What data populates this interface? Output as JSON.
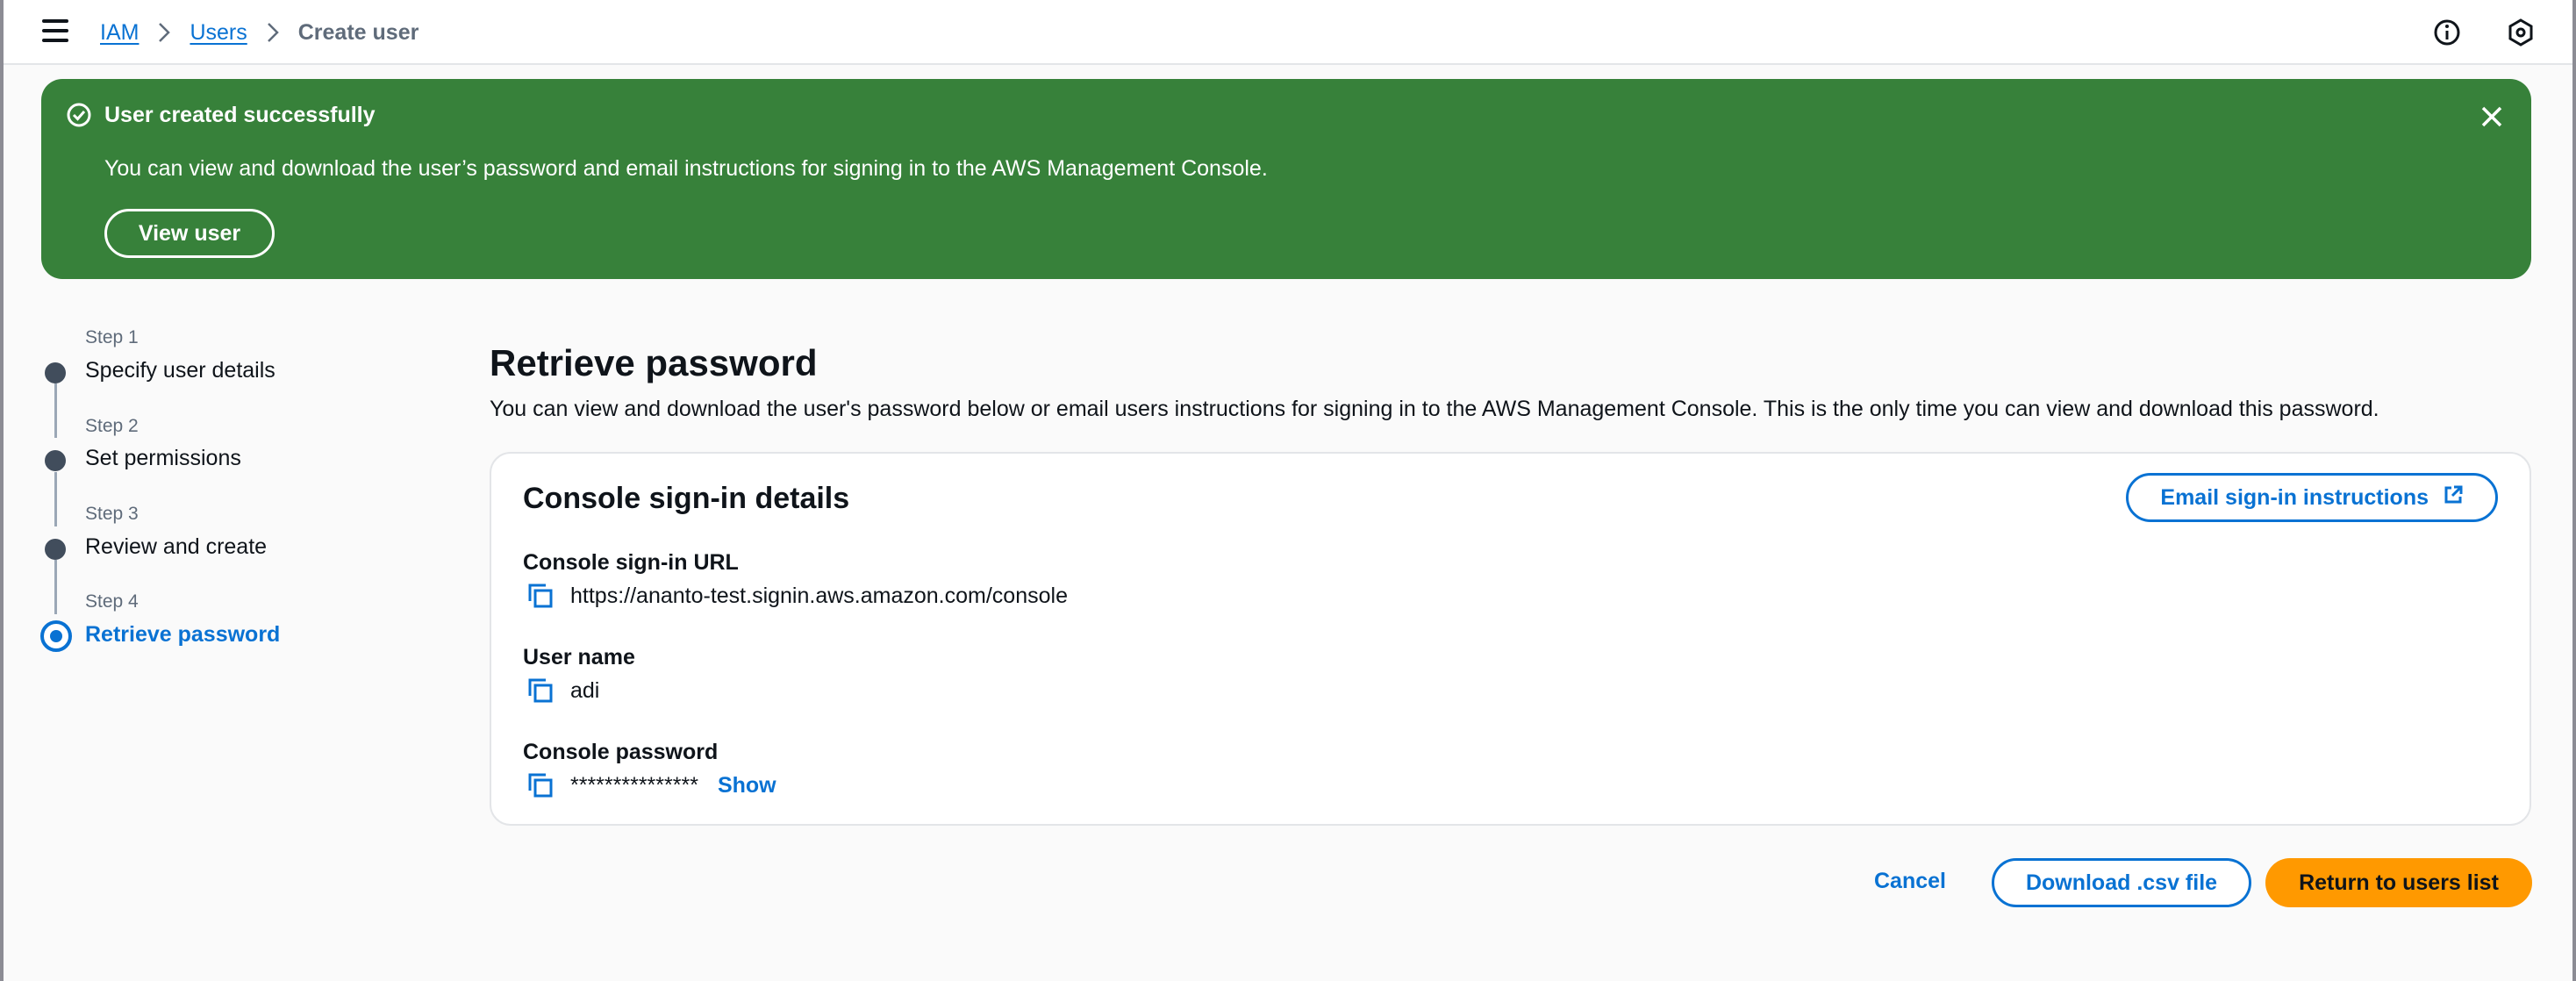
{
  "breadcrumb": {
    "items": [
      "IAM",
      "Users"
    ],
    "current": "Create user"
  },
  "flash": {
    "title": "User created successfully",
    "message": "You can view and download the user’s password and email instructions for signing in to the AWS Management Console.",
    "button": "View user",
    "color": "#37813a"
  },
  "steps": [
    {
      "num": "Step 1",
      "label": "Specify user details"
    },
    {
      "num": "Step 2",
      "label": "Set permissions"
    },
    {
      "num": "Step 3",
      "label": "Review and create"
    },
    {
      "num": "Step 4",
      "label": "Retrieve password"
    }
  ],
  "main": {
    "title": "Retrieve password",
    "description": "You can view and download the user's password below or email users instructions for signing in to the AWS Management Console. This is the only time you can view and download this password."
  },
  "card": {
    "title": "Console sign-in details",
    "email_button": "Email sign-in instructions",
    "fields": [
      {
        "label": "Console sign-in URL",
        "value": "https://ananto-test.signin.aws.amazon.com/console"
      },
      {
        "label": "User name",
        "value": "adi"
      },
      {
        "label": "Console password",
        "value": "***************",
        "action": "Show"
      }
    ]
  },
  "actions": {
    "cancel": "Cancel",
    "download": "Download .csv file",
    "return": "Return to users list"
  },
  "colors": {
    "link": "#0972d3",
    "primary_button": "#ff9900"
  },
  "icons": [
    "menu-icon",
    "chevron-right-icon",
    "info-icon",
    "settings-icon",
    "check-circle-icon",
    "close-icon",
    "external-link-icon",
    "copy-icon"
  ]
}
